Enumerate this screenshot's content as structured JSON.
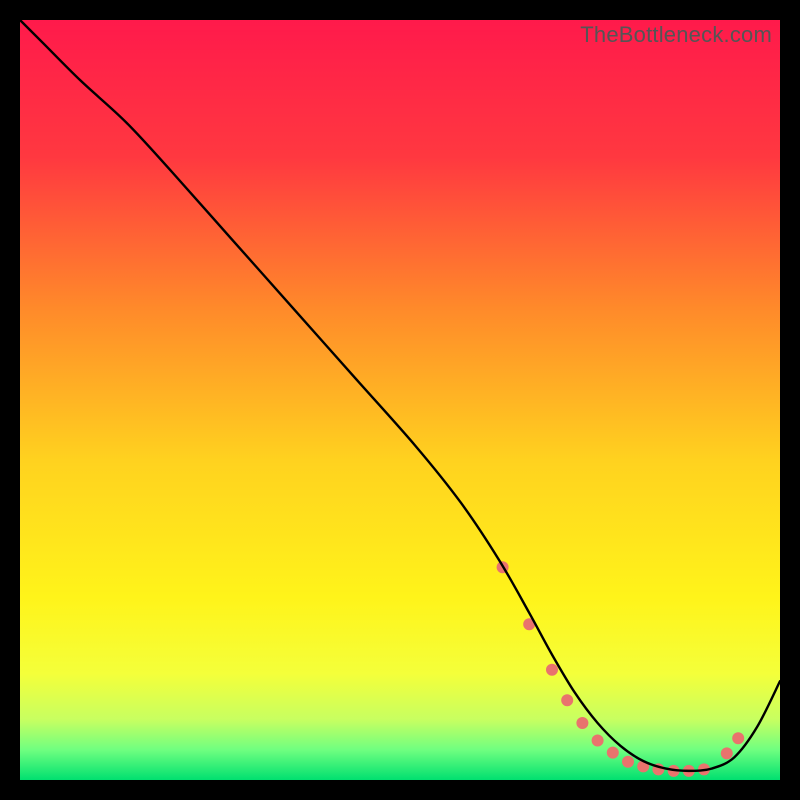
{
  "watermark": "TheBottleneck.com",
  "chart_data": {
    "type": "line",
    "title": "",
    "xlabel": "",
    "ylabel": "",
    "xlim": [
      0,
      100
    ],
    "ylim": [
      0,
      100
    ],
    "gradient_stops": [
      {
        "offset": 0.0,
        "color": "#ff1a4b"
      },
      {
        "offset": 0.18,
        "color": "#ff3840"
      },
      {
        "offset": 0.38,
        "color": "#ff8a2a"
      },
      {
        "offset": 0.58,
        "color": "#ffd21f"
      },
      {
        "offset": 0.76,
        "color": "#fff41a"
      },
      {
        "offset": 0.86,
        "color": "#f4ff3a"
      },
      {
        "offset": 0.92,
        "color": "#c8ff60"
      },
      {
        "offset": 0.96,
        "color": "#70ff80"
      },
      {
        "offset": 1.0,
        "color": "#00e070"
      }
    ],
    "series": [
      {
        "name": "bottleneck-curve",
        "color": "#000000",
        "x": [
          0,
          3,
          8,
          14,
          20,
          28,
          36,
          44,
          52,
          58,
          63,
          67,
          70,
          73,
          76,
          79,
          82,
          85,
          88,
          91,
          94,
          97,
          100
        ],
        "y": [
          100,
          97,
          92,
          86.5,
          80,
          71,
          62,
          53,
          44,
          36.5,
          29,
          22,
          16.5,
          11.5,
          7.5,
          4.5,
          2.5,
          1.5,
          1.2,
          1.5,
          3,
          7,
          13
        ]
      }
    ],
    "markers": {
      "name": "highlight-dots",
      "color": "#e9736d",
      "x": [
        63.5,
        67,
        70,
        72,
        74,
        76,
        78,
        80,
        82,
        84,
        86,
        88,
        90,
        93,
        94.5
      ],
      "y": [
        28,
        20.5,
        14.5,
        10.5,
        7.5,
        5.2,
        3.6,
        2.4,
        1.8,
        1.4,
        1.2,
        1.2,
        1.4,
        3.5,
        5.5
      ]
    }
  }
}
